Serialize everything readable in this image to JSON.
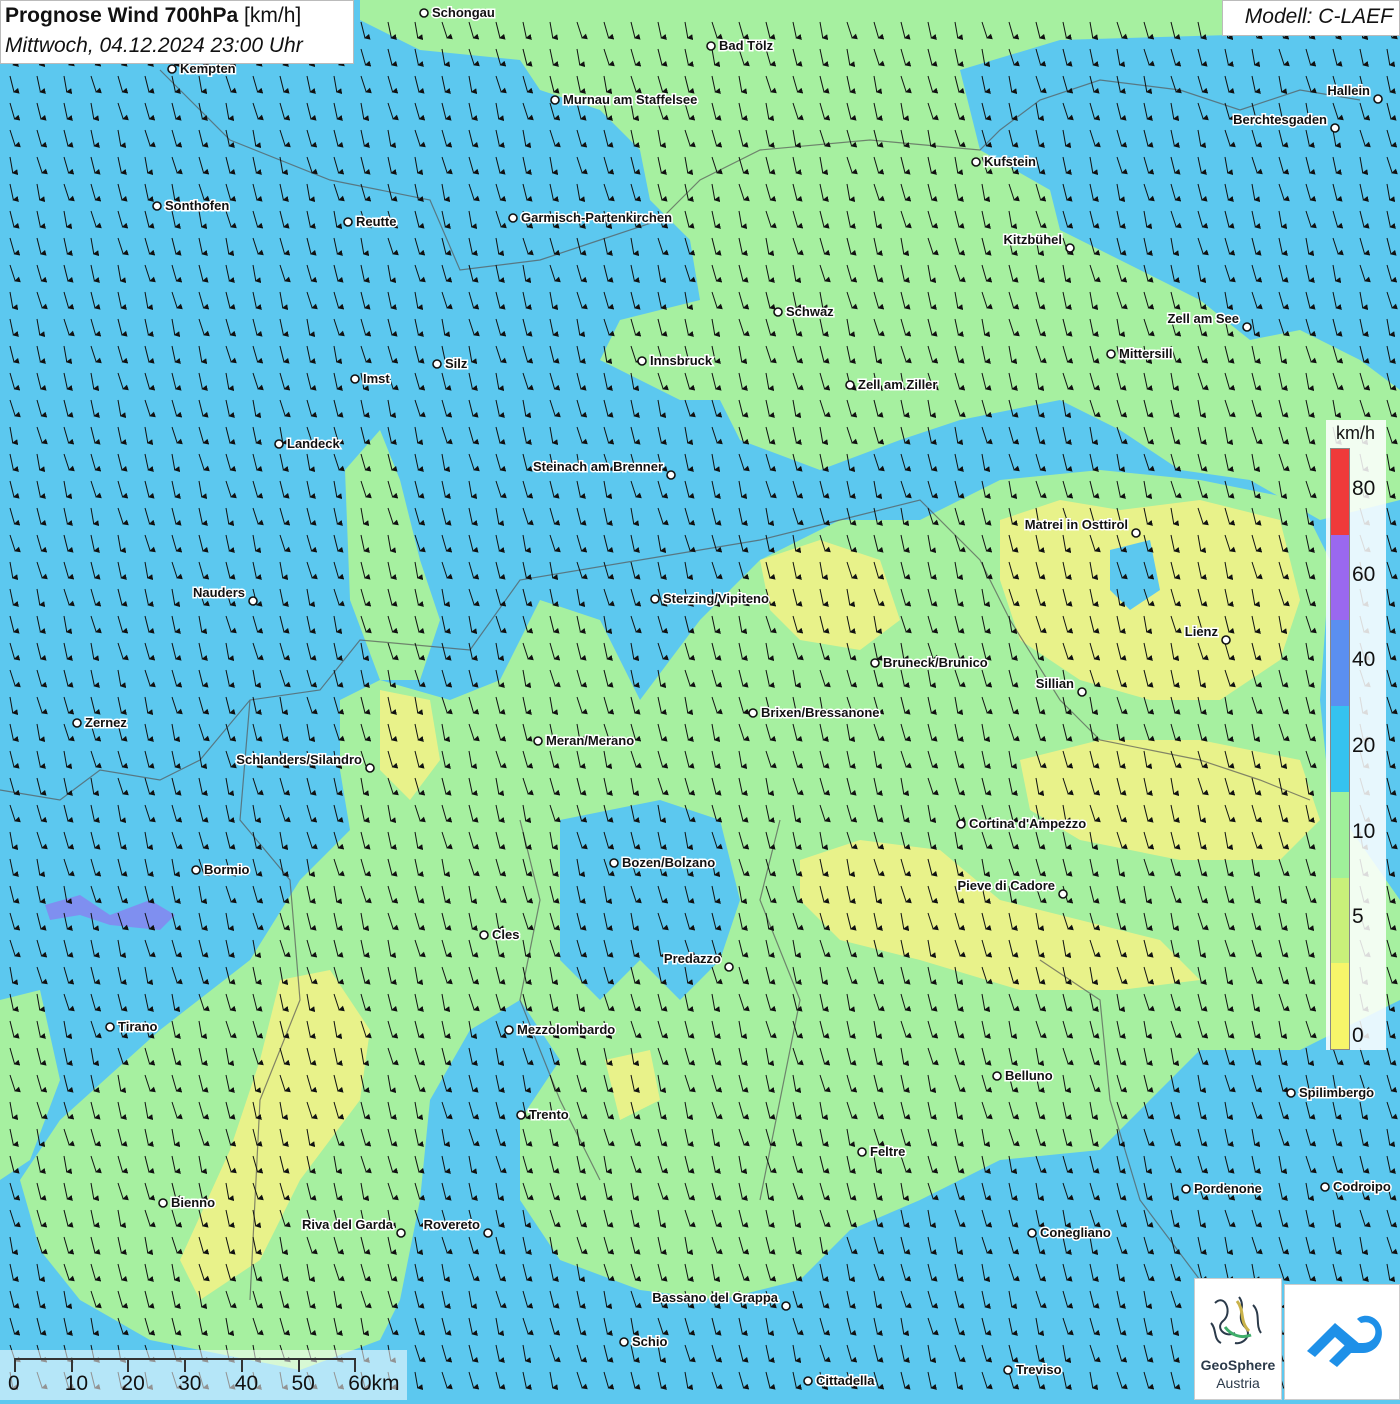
{
  "header": {
    "title_bold": "Prognose Wind 700hPa",
    "title_unit": "[km/h]",
    "subtitle": "Mittwoch, 04.12.2024 23:00 Uhr",
    "model": "Modell: C-LAEF"
  },
  "legend": {
    "unit": "km/h",
    "stops": [
      {
        "label": "0",
        "color": "#f7f56a"
      },
      {
        "label": "5",
        "color": "#c9f07a"
      },
      {
        "label": "10",
        "color": "#9ff09a"
      },
      {
        "label": "20",
        "color": "#35c3ef"
      },
      {
        "label": "40",
        "color": "#5b8ff0"
      },
      {
        "label": "60",
        "color": "#9a68ef"
      },
      {
        "label": "80",
        "color": "#ef3a3a"
      }
    ]
  },
  "scalebar": {
    "labels": [
      "0",
      "10",
      "20",
      "30",
      "40",
      "50",
      "60km"
    ]
  },
  "logos": {
    "geosphere_line1": "GeoSphere",
    "geosphere_line2": "Austria",
    "app_icon": "cloud-arrow-icon"
  },
  "cities": [
    {
      "name": "Schongau"
    },
    {
      "name": "Kempten"
    },
    {
      "name": "Bad Tölz"
    },
    {
      "name": "Murnau am Staffelsee"
    },
    {
      "name": "Hallein"
    },
    {
      "name": "Berchtesgaden"
    },
    {
      "name": "Kufstein"
    },
    {
      "name": "Sonthofen"
    },
    {
      "name": "Reutte"
    },
    {
      "name": "Garmisch-Partenkirchen"
    },
    {
      "name": "Kitzbühel"
    },
    {
      "name": "Schwaz"
    },
    {
      "name": "Zell am See"
    },
    {
      "name": "Mittersill"
    },
    {
      "name": "Innsbruck"
    },
    {
      "name": "Silz"
    },
    {
      "name": "Imst"
    },
    {
      "name": "Zell am Ziller"
    },
    {
      "name": "Landeck"
    },
    {
      "name": "Steinach am Brenner"
    },
    {
      "name": "Matrei in Osttirol"
    },
    {
      "name": "Nauders"
    },
    {
      "name": "Sterzing/Vipiteno"
    },
    {
      "name": "Lienz"
    },
    {
      "name": "Bruneck/Brunico"
    },
    {
      "name": "Sillian"
    },
    {
      "name": "Zernez"
    },
    {
      "name": "Brixen/Bressanone"
    },
    {
      "name": "Meran/Merano"
    },
    {
      "name": "Schlanders/Silandro"
    },
    {
      "name": "Cortina d'Ampezzo"
    },
    {
      "name": "Bozen/Bolzano"
    },
    {
      "name": "Bormio"
    },
    {
      "name": "Pieve di Cadore"
    },
    {
      "name": "Cles"
    },
    {
      "name": "Predazzo"
    },
    {
      "name": "Tirano"
    },
    {
      "name": "Mezzolombardo"
    },
    {
      "name": "Belluno"
    },
    {
      "name": "Spilimbergo"
    },
    {
      "name": "Trento"
    },
    {
      "name": "Feltre"
    },
    {
      "name": "Pordenone"
    },
    {
      "name": "Codroipo"
    },
    {
      "name": "Bienno"
    },
    {
      "name": "Riva del Garda"
    },
    {
      "name": "Rovereto"
    },
    {
      "name": "Conegliano"
    },
    {
      "name": "Bassano del Grappa"
    },
    {
      "name": "Schio"
    },
    {
      "name": "Treviso"
    },
    {
      "name": "Cittadella"
    }
  ],
  "colors": {
    "sea": "#5cc8ef",
    "green": "#a6f0a0",
    "yellow": "#e8f28a",
    "purple": "#7f8ff0"
  }
}
